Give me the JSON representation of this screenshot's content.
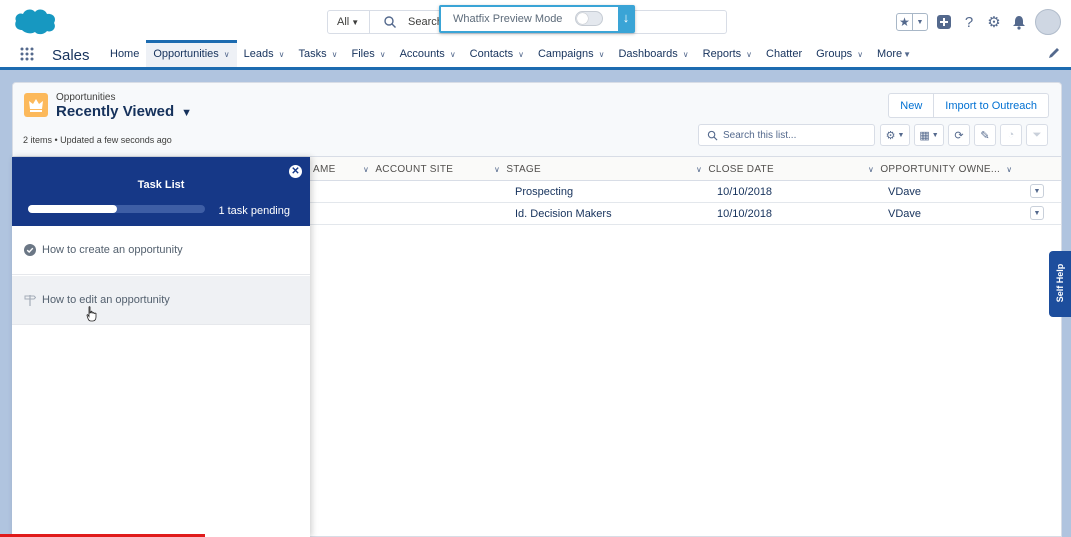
{
  "header": {
    "search_scope": "All",
    "search_placeholder": "Search"
  },
  "whatfix": {
    "label": "Whatfix Preview Mode",
    "toggle_on": false
  },
  "nav": {
    "app_name": "Sales",
    "items": [
      {
        "label": "Home",
        "has_menu": false,
        "active": false
      },
      {
        "label": "Opportunities",
        "has_menu": true,
        "active": true
      },
      {
        "label": "Leads",
        "has_menu": true,
        "active": false
      },
      {
        "label": "Tasks",
        "has_menu": true,
        "active": false
      },
      {
        "label": "Files",
        "has_menu": true,
        "active": false
      },
      {
        "label": "Accounts",
        "has_menu": true,
        "active": false
      },
      {
        "label": "Contacts",
        "has_menu": true,
        "active": false
      },
      {
        "label": "Campaigns",
        "has_menu": true,
        "active": false
      },
      {
        "label": "Dashboards",
        "has_menu": true,
        "active": false
      },
      {
        "label": "Reports",
        "has_menu": true,
        "active": false
      },
      {
        "label": "Chatter",
        "has_menu": false,
        "active": false
      },
      {
        "label": "Groups",
        "has_menu": true,
        "active": false
      },
      {
        "label": "More",
        "has_menu": false,
        "active": false
      }
    ]
  },
  "list_view": {
    "object_label": "Opportunities",
    "title": "Recently Viewed",
    "meta": "2 items • Updated a few seconds ago",
    "buttons": [
      "New",
      "Import to Outreach"
    ],
    "search_placeholder": "Search this list..."
  },
  "table": {
    "columns": [
      "AME",
      "ACCOUNT SITE",
      "STAGE",
      "CLOSE DATE",
      "OPPORTUNITY OWNE..."
    ],
    "rows": [
      {
        "stage": "Prospecting",
        "close_date": "10/10/2018",
        "owner": "VDave"
      },
      {
        "stage": "Id. Decision Makers",
        "close_date": "10/10/2018",
        "owner": "VDave"
      }
    ]
  },
  "task_list": {
    "title": "Task List",
    "progress": 0.5,
    "pending": "1 task pending",
    "tasks": [
      {
        "label": "How to create an opportunity",
        "done": true
      },
      {
        "label": "How to edit an opportunity",
        "done": false
      }
    ]
  },
  "self_help": "Self Help",
  "colors": {
    "brand_blue": "#1c6bb0",
    "task_header": "#163887",
    "whatfix_accent": "#3aa4d6",
    "object_icon": "#fcb95b"
  }
}
